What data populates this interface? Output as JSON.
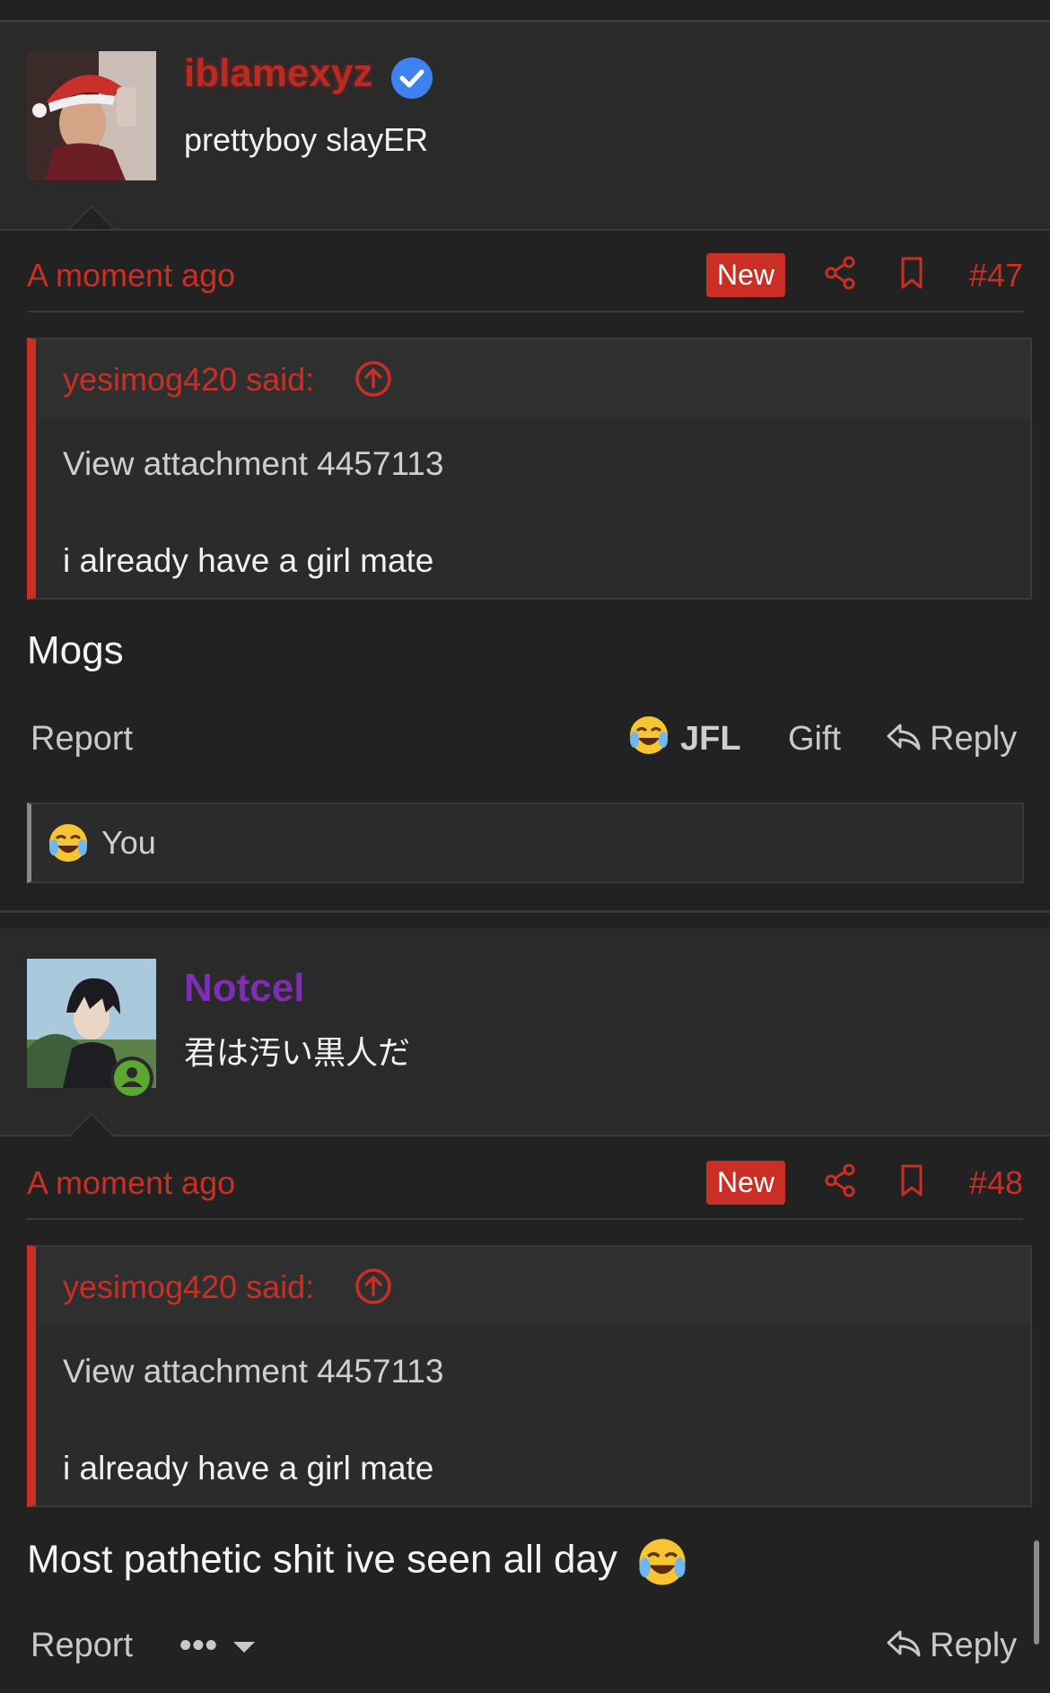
{
  "posts": [
    {
      "username": "iblamexyz",
      "username_color": "#b92b23",
      "verified": true,
      "user_title": "prettyboy slayER",
      "timestamp": "A moment ago",
      "new_badge": "New",
      "post_number": "#47",
      "quote": {
        "author": "yesimog420 said:",
        "line1": "View attachment 4457113",
        "line2": "i already have a girl mate"
      },
      "body": "Mogs",
      "actions": {
        "report": "Report",
        "reaction": "JFL",
        "gift": "Gift",
        "reply": "Reply"
      },
      "reactions_by": "You"
    },
    {
      "username": "Notcel",
      "username_color": "#7e2db5",
      "user_title": "君は汚い黒人だ",
      "timestamp": "A moment ago",
      "new_badge": "New",
      "post_number": "#48",
      "quote": {
        "author": "yesimog420 said:",
        "line1": "View attachment 4457113",
        "line2": "i already have a girl mate"
      },
      "body": "Most pathetic shit ive seen all day",
      "actions": {
        "report": "Report",
        "more": "•••",
        "reply": "Reply"
      }
    }
  ],
  "colors": {
    "accent": "#c92f25",
    "background": "#222223",
    "panel": "#2a2a2b",
    "verified": "#3d82f0",
    "online": "#5aa82f"
  }
}
